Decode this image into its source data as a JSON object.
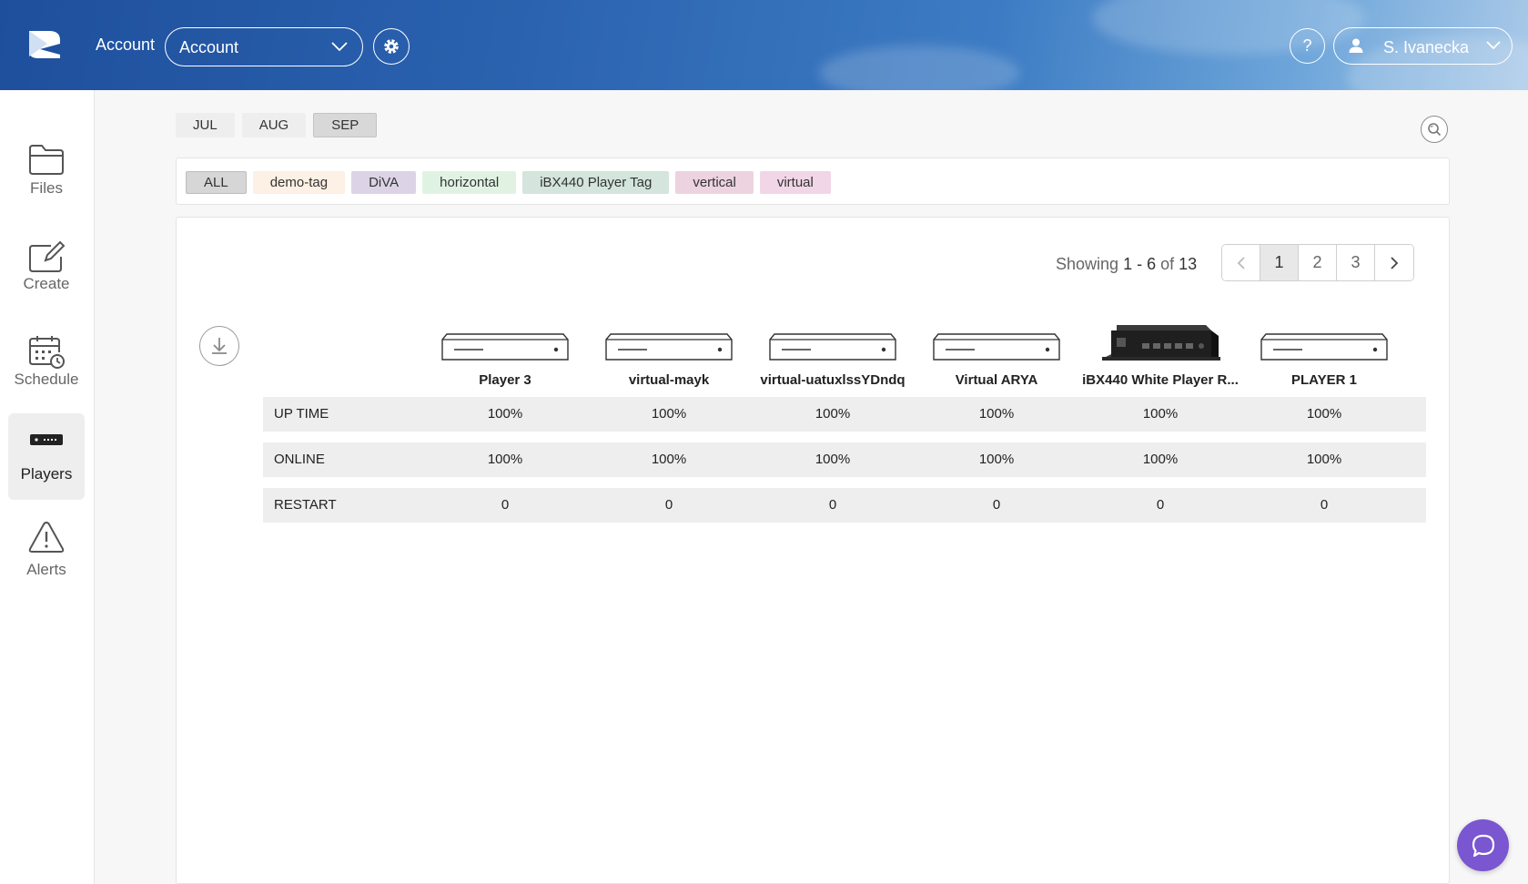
{
  "header": {
    "account_label": "Account",
    "account_select_value": "Account",
    "help_label": "?",
    "user_name": "S. Ivanecka"
  },
  "sidebar": {
    "items": [
      {
        "label": "Files",
        "icon": "folder-icon"
      },
      {
        "label": "Create",
        "icon": "create-icon"
      },
      {
        "label": "Schedule",
        "icon": "calendar-clock-icon"
      },
      {
        "label": "Players",
        "icon": "player-device-icon",
        "active": true
      },
      {
        "label": "Alerts",
        "icon": "warning-icon"
      }
    ]
  },
  "months": [
    {
      "label": "JUL"
    },
    {
      "label": "AUG"
    },
    {
      "label": "SEP",
      "active": true
    }
  ],
  "tags": [
    {
      "label": "ALL",
      "color": "#d6d6d6"
    },
    {
      "label": "demo-tag",
      "color": "#fdf0e4"
    },
    {
      "label": "DiVA",
      "color": "#dcd4e6"
    },
    {
      "label": "horizontal",
      "color": "#e0f3e3"
    },
    {
      "label": "iBX440 Player Tag",
      "color": "#d3e5dc"
    },
    {
      "label": "vertical",
      "color": "#ecd3df"
    },
    {
      "label": "virtual",
      "color": "#f1d6e7"
    }
  ],
  "pagination": {
    "showing_prefix": "Showing",
    "range_start": "1",
    "range_sep": "-",
    "range_end": "6",
    "of_label": "of",
    "total": "13",
    "pages": [
      "1",
      "2",
      "3"
    ],
    "current": "1"
  },
  "players": [
    {
      "name": "Player 3",
      "thumb": "generic"
    },
    {
      "name": "virtual-mayk",
      "thumb": "generic"
    },
    {
      "name": "virtual-uatuxlssYDndq",
      "thumb": "generic"
    },
    {
      "name": "Virtual ARYA",
      "thumb": "generic"
    },
    {
      "name": "iBX440 White Player R...",
      "thumb": "ibx"
    },
    {
      "name": "PLAYER 1",
      "thumb": "generic"
    }
  ],
  "stats": [
    {
      "label": "UP TIME",
      "values": [
        "100%",
        "100%",
        "100%",
        "100%",
        "100%",
        "100%"
      ]
    },
    {
      "label": "ONLINE",
      "values": [
        "100%",
        "100%",
        "100%",
        "100%",
        "100%",
        "100%"
      ]
    },
    {
      "label": "RESTART",
      "values": [
        "0",
        "0",
        "0",
        "0",
        "0",
        "0"
      ]
    }
  ],
  "colors": {
    "header_blue": "#2b63b0",
    "chat_purple": "#7a56d0"
  }
}
